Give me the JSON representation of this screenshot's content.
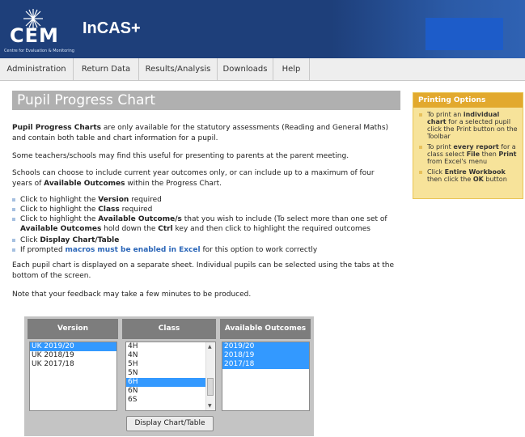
{
  "header": {
    "logo_text": "CEM",
    "logo_subtitle": "Centre for Evaluation & Monitoring",
    "app_name": "InCAS+"
  },
  "nav": {
    "items": [
      "Administration",
      "Return Data",
      "Results/Analysis",
      "Downloads",
      "Help"
    ]
  },
  "page": {
    "title": "Pupil Progress Chart",
    "intro_bold": "Pupil Progress Charts",
    "intro_rest": " are only available for the statutory assessments (Reading and General Maths) and contain both table and chart information for a pupil.",
    "para2": "Some teachers/schools may find this useful for presenting to parents at the parent meeting.",
    "para3_a": "Schools can choose to include current year outcomes only, or can include up to a maximum of four years of ",
    "para3_bold": "Available Outcomes",
    "para3_b": " within the Progress Chart.",
    "bullets": {
      "b1_a": "Click to highlight the ",
      "b1_bold": "Version",
      "b1_b": " required",
      "b2_a": "Click to highlight the ",
      "b2_bold": "Class",
      "b2_b": " required",
      "b3_a": "Click to highlight the ",
      "b3_bold": "Available Outcome/s",
      "b3_b": " that you wish to include (To select more than one set of ",
      "b3_bold2": "Available Outcomes",
      "b3_c": " hold down the ",
      "b3_bold3": "Ctrl",
      "b3_d": " key and then click to highlight the required outcomes",
      "b4_a": "Click ",
      "b4_bold": "Display Chart/Table",
      "b5_a": "If prompted ",
      "b5_link": "macros must be enabled in Excel",
      "b5_b": " for this option to work correctly"
    },
    "para4": "Each pupil chart is displayed on a separate sheet.  Individual pupils can be selected using the tabs at the bottom of the screen.",
    "para5": "Note that your feedback may take a few minutes to be produced."
  },
  "selector": {
    "version_header": "Version",
    "class_header": "Class",
    "outcomes_header": "Available Outcomes",
    "versions": [
      "UK 2019/20",
      "UK 2018/19",
      "UK 2017/18"
    ],
    "classes": [
      "4H",
      "4N",
      "5H",
      "5N",
      "6H",
      "6N",
      "6S"
    ],
    "outcomes": [
      "2019/20",
      "2018/19",
      "2017/18"
    ],
    "button_label": "Display Chart/Table"
  },
  "printing": {
    "title": "Printing Options",
    "i1_a": "To print an ",
    "i1_bold": "individual chart",
    "i1_b": " for a selected pupil click the Print button on the Toolbar",
    "i2_a": "To print ",
    "i2_bold": "every report",
    "i2_b": " for a class select ",
    "i2_bold2": "File",
    "i2_c": " then ",
    "i2_bold3": "Print",
    "i2_d": " from Excel's menu",
    "i3_a": "Click ",
    "i3_bold": "Entire Workbook",
    "i3_b": " then click the ",
    "i3_bold2": "OK",
    "i3_c": " button"
  },
  "colors": {
    "header_bg": "#1e3f7a",
    "title_bar": "#b0b0b0",
    "selection": "#3399ff",
    "print_header": "#e2a92e",
    "print_box": "#f7e39a"
  }
}
